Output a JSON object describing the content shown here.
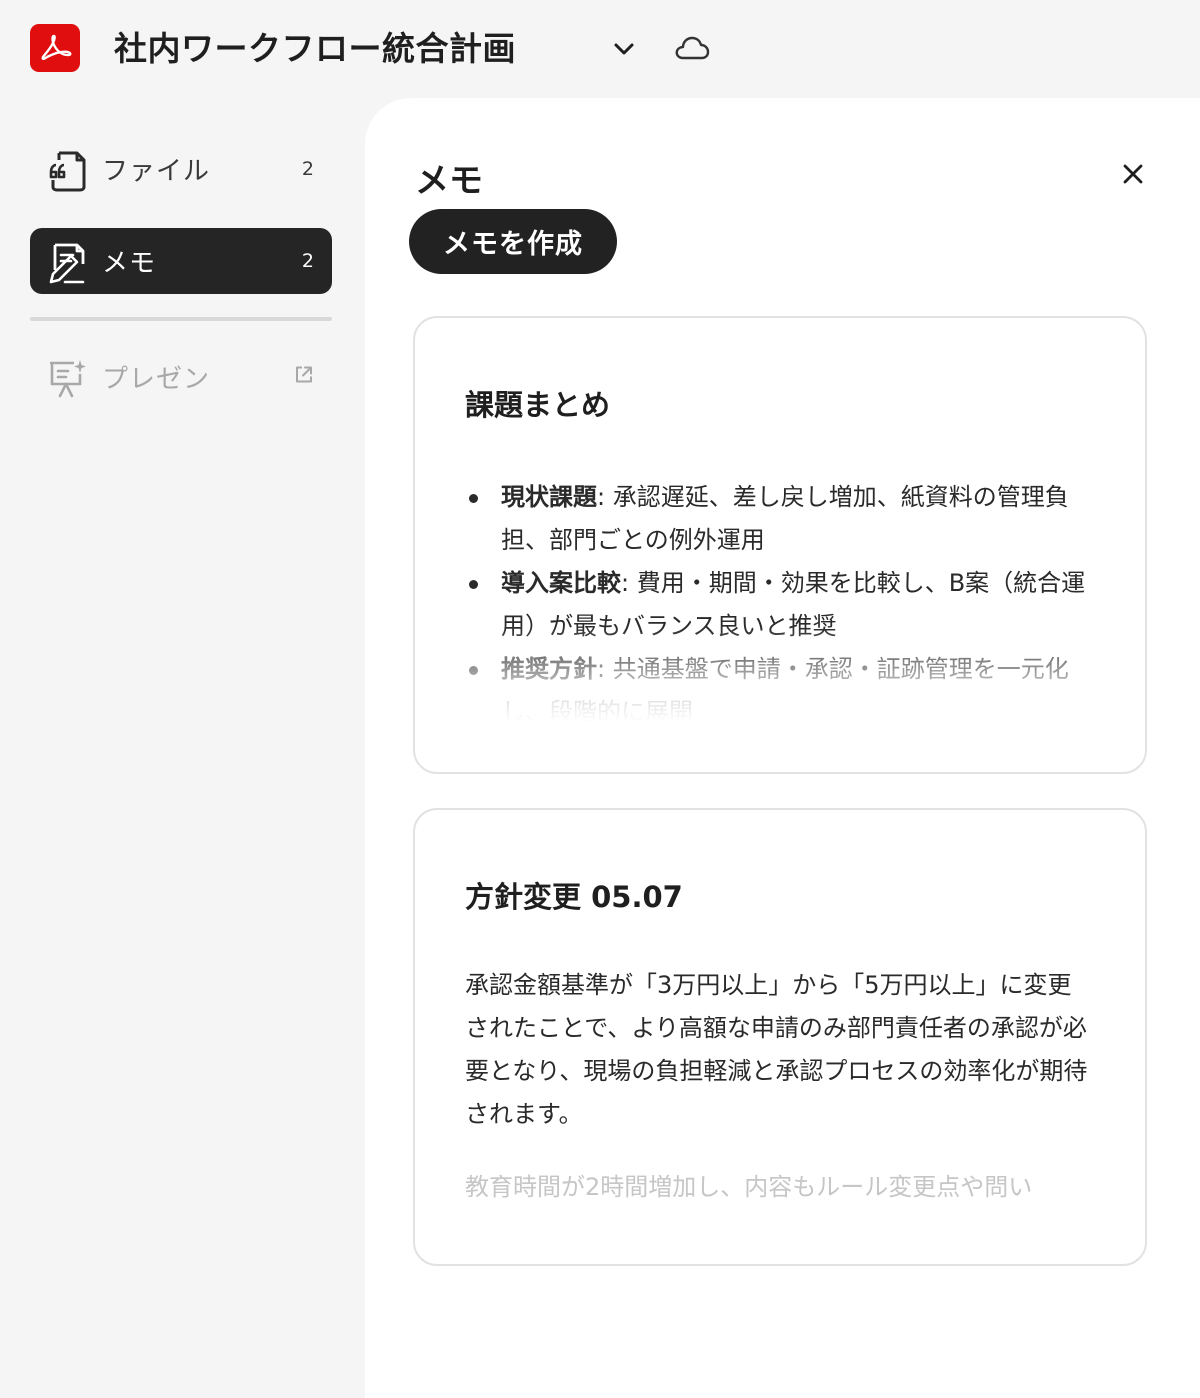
{
  "header": {
    "app_icon": "acrobat-logo-icon",
    "title": "社内ワークフロー統合計画",
    "menu_icon": "chevron-down-icon",
    "cloud_icon": "cloud-icon",
    "brand_color": "#e00e0e"
  },
  "sidebar": {
    "items": [
      {
        "label": "ファイル",
        "count": "2",
        "icon": "file-quote-icon",
        "selected": false
      },
      {
        "label": "メモ",
        "count": "2",
        "icon": "note-edit-icon",
        "selected": true
      },
      {
        "label": "プレゼン",
        "icon": "presentation-sparkle-icon",
        "trailing_icon": "external-link-icon",
        "disabled": true
      }
    ]
  },
  "panel": {
    "title": "メモ",
    "close_icon": "close-icon",
    "create_button": "メモを作成"
  },
  "notes": [
    {
      "title": "課題まとめ",
      "bullets": [
        {
          "term": "現状課題",
          "text": ": 承認遅延、差し戻し増加、紙資料の管理負担、部門ごとの例外運用"
        },
        {
          "term": "導入案比較",
          "text": ": 費用・期間・効果を比較し、B案（統合運用）が最もバランス良いと推奨"
        },
        {
          "term": "推奨方針",
          "text": ": 共通基盤で申請・承認・証跡管理を一元化し、段階的に展開"
        }
      ]
    },
    {
      "title": "方針変更 05.07",
      "paragraph": "承認金額基準が「3万円以上」から「5万円以上」に変更されたことで、より高額な申請のみ部門責任者の承認が必要となり、現場の負担軽減と承認プロセスの効率化が期待されます。",
      "faded_text": "教育時間が2時間増加し、内容もルール変更点や問い"
    }
  ]
}
